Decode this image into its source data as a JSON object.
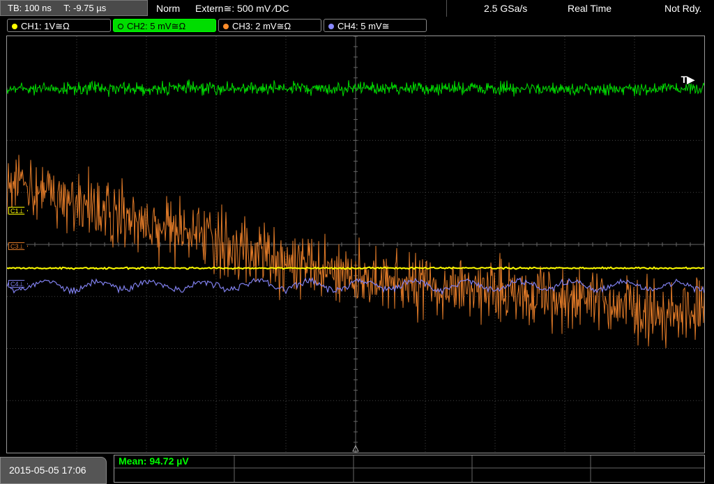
{
  "topbar": {
    "timebase": "TB: 100 ns",
    "trigger_time": "T: -9.75 µs",
    "mode": "Norm",
    "trigger_source": "Extern≅: 500 mV ⁄DC",
    "sample_rate": "2.5 GSa/s",
    "acq_mode": "Real Time",
    "status": "Not Rdy."
  },
  "channels": [
    {
      "label": "CH1: 1V≅Ω",
      "color": "#ffff00"
    },
    {
      "label": "CH2: 5 mV≅Ω",
      "color": "#00dd00"
    },
    {
      "label": "CH3: 2 mV≅Ω",
      "color": "#ff8c2a"
    },
    {
      "label": "CH4: 5 mV≅",
      "color": "#8888ff"
    }
  ],
  "markers": {
    "c1": "C1",
    "c3": "C3",
    "c4": "C4",
    "trigger_pos": "T▶"
  },
  "bottom": {
    "datetime": "2015-05-05 17:06",
    "mean": "Mean: 94.72 µV"
  },
  "colors": {
    "ch1": "#ffff00",
    "ch2": "#00dd00",
    "ch3": "#e07a28",
    "ch4": "#8080ee",
    "grid": "#444444"
  }
}
